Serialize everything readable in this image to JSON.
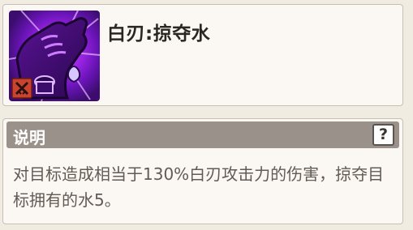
{
  "skill": {
    "name": "白刃:掠夺水",
    "icon": "hand-grab-water-icon",
    "type_badge_icon": "crossed-swords-icon",
    "icon_colors": {
      "frame": "#3c0d6e",
      "glow": "#b02cf7",
      "badge": "#c9442f"
    }
  },
  "description": {
    "header_label": "说明",
    "help_label": "?",
    "text": "对目标造成相当于130%白刃攻击力的伤害，掠夺目标拥有的水5。"
  }
}
